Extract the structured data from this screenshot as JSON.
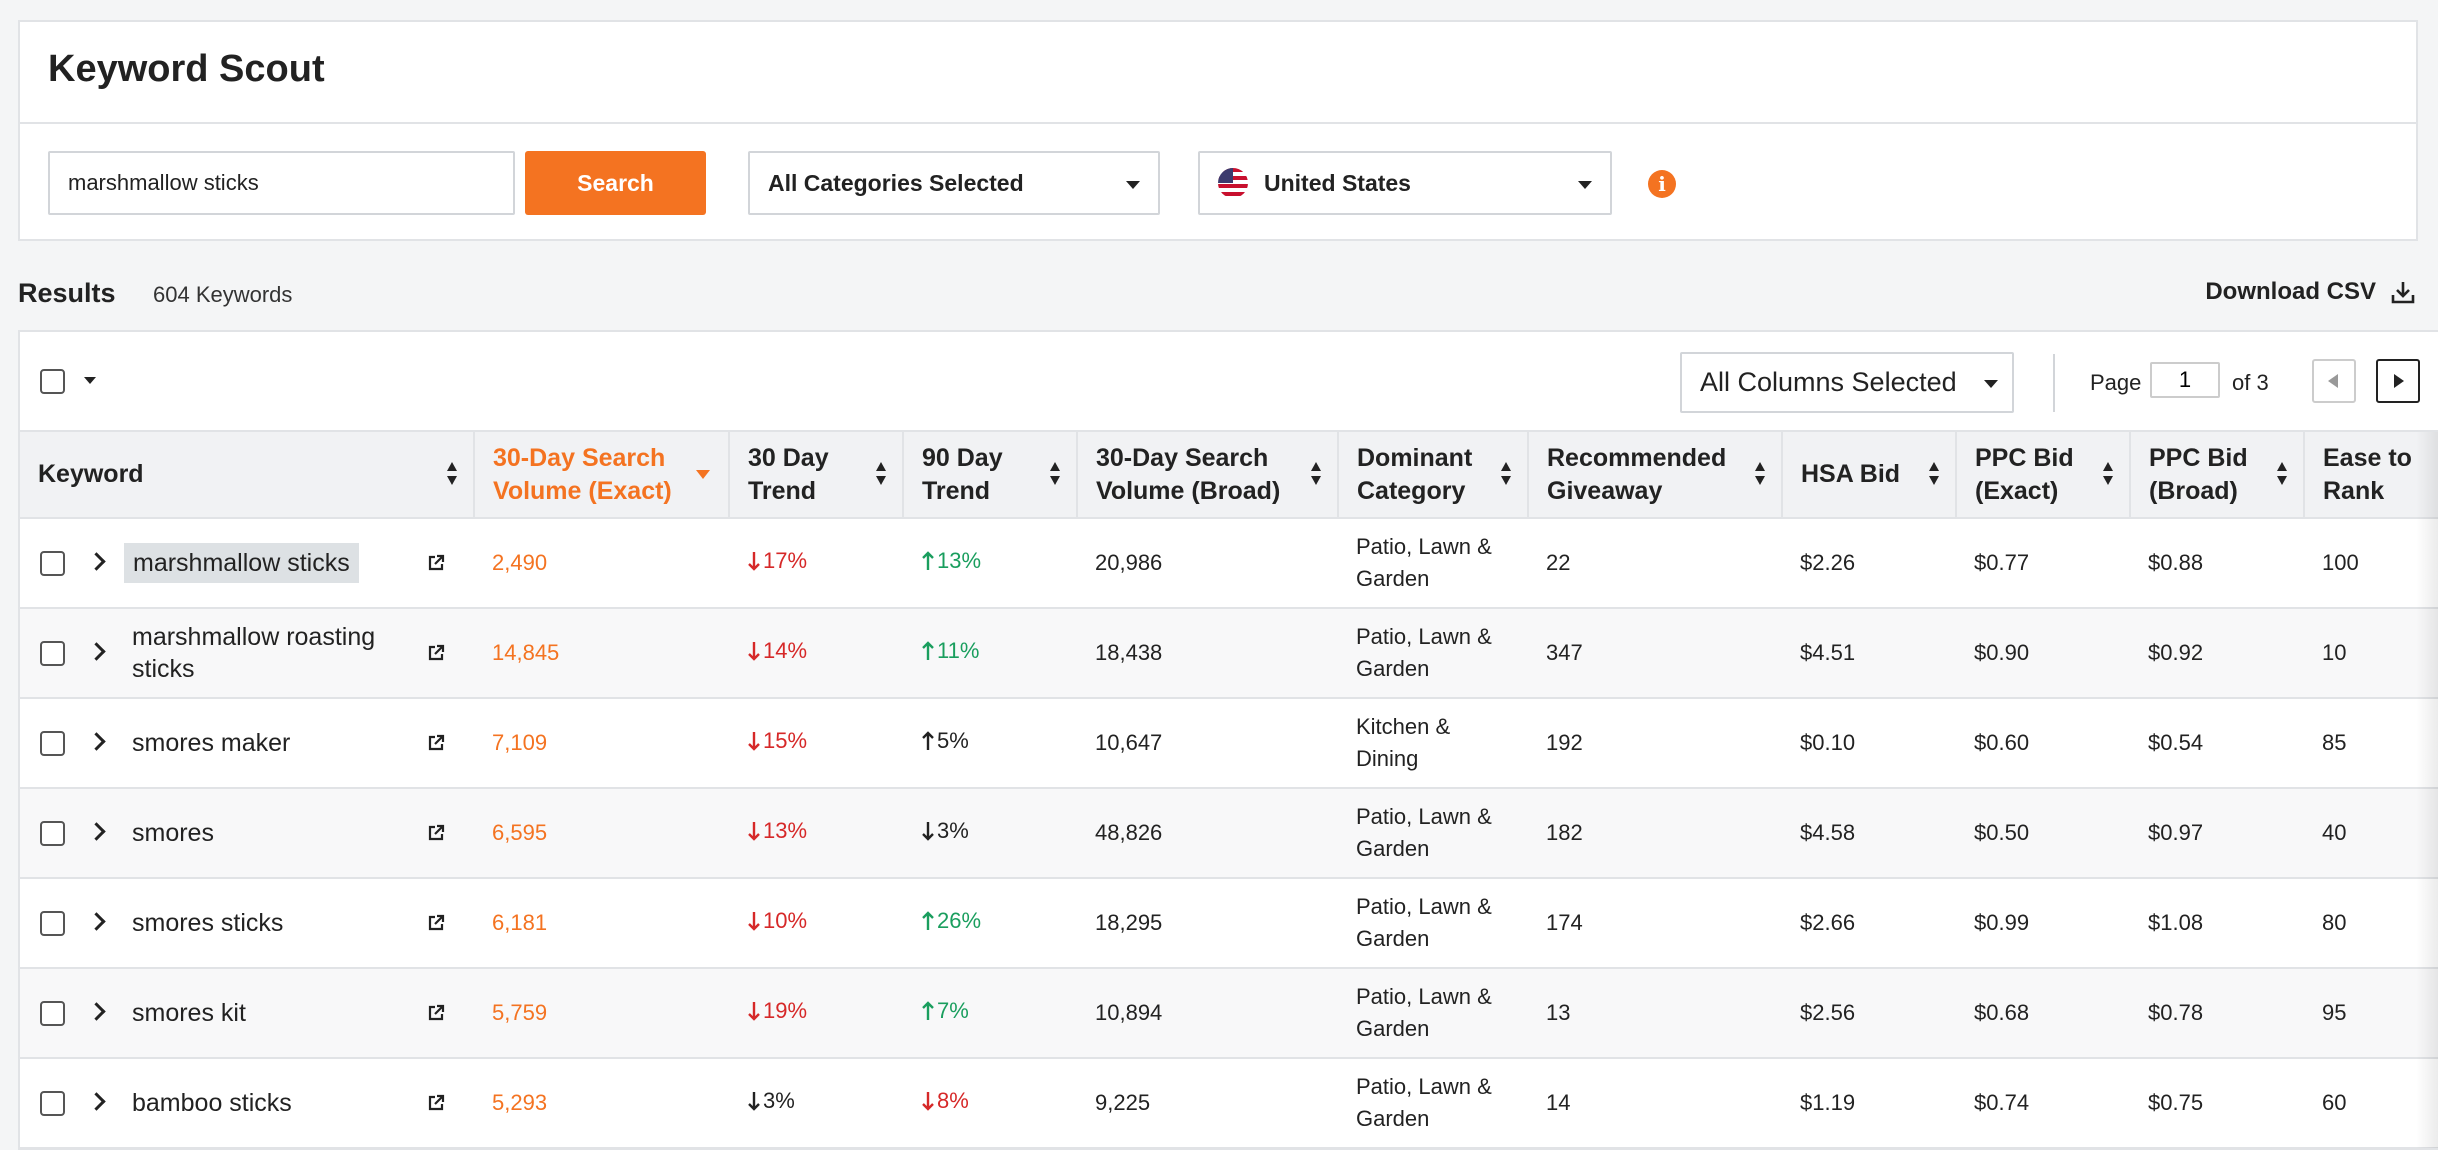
{
  "app": {
    "title": "Keyword Scout"
  },
  "search": {
    "value": "marshmallow sticks",
    "button_label": "Search"
  },
  "filters": {
    "category": "All Categories Selected",
    "country": "United States"
  },
  "results": {
    "label": "Results",
    "count": "604 Keywords",
    "download_label": "Download CSV"
  },
  "toolbar": {
    "columns_select": "All Columns Selected",
    "page_label": "Page",
    "page_value": "1",
    "page_of": "of 3"
  },
  "columns": [
    "Keyword",
    "30-Day Search Volume (Exact)",
    "30 Day Trend",
    "90 Day Trend",
    "30-Day Search Volume (Broad)",
    "Dominant Category",
    "Recommended Giveaway",
    "HSA Bid",
    "PPC Bid (Exact)",
    "PPC Bid (Broad)",
    "Ease to Rank"
  ],
  "rows": [
    {
      "keyword": "marshmallow sticks",
      "volume_exact": "2,490",
      "trend30": "17%",
      "trend30_dir": "down",
      "trend90": "13%",
      "trend90_dir": "up",
      "volume_broad": "20,986",
      "category": "Patio, Lawn & Garden",
      "giveaway": "22",
      "hsa": "$2.26",
      "ppc_exact": "$0.77",
      "ppc_broad": "$0.88",
      "ease": "100"
    },
    {
      "keyword": "marshmallow roasting sticks",
      "volume_exact": "14,845",
      "trend30": "14%",
      "trend30_dir": "down",
      "trend90": "11%",
      "trend90_dir": "up",
      "volume_broad": "18,438",
      "category": "Patio, Lawn & Garden",
      "giveaway": "347",
      "hsa": "$4.51",
      "ppc_exact": "$0.90",
      "ppc_broad": "$0.92",
      "ease": "10"
    },
    {
      "keyword": "smores maker",
      "volume_exact": "7,109",
      "trend30": "15%",
      "trend30_dir": "down",
      "trend90": "5%",
      "trend90_dir": "up-neutral",
      "volume_broad": "10,647",
      "category": "Kitchen & Dining",
      "giveaway": "192",
      "hsa": "$0.10",
      "ppc_exact": "$0.60",
      "ppc_broad": "$0.54",
      "ease": "85"
    },
    {
      "keyword": "smores",
      "volume_exact": "6,595",
      "trend30": "13%",
      "trend30_dir": "down",
      "trend90": "3%",
      "trend90_dir": "down-neutral",
      "volume_broad": "48,826",
      "category": "Patio, Lawn & Garden",
      "giveaway": "182",
      "hsa": "$4.58",
      "ppc_exact": "$0.50",
      "ppc_broad": "$0.97",
      "ease": "40"
    },
    {
      "keyword": "smores sticks",
      "volume_exact": "6,181",
      "trend30": "10%",
      "trend30_dir": "down",
      "trend90": "26%",
      "trend90_dir": "up",
      "volume_broad": "18,295",
      "category": "Patio, Lawn & Garden",
      "giveaway": "174",
      "hsa": "$2.66",
      "ppc_exact": "$0.99",
      "ppc_broad": "$1.08",
      "ease": "80"
    },
    {
      "keyword": "smores kit",
      "volume_exact": "5,759",
      "trend30": "19%",
      "trend30_dir": "down",
      "trend90": "7%",
      "trend90_dir": "up",
      "volume_broad": "10,894",
      "category": "Patio, Lawn & Garden",
      "giveaway": "13",
      "hsa": "$2.56",
      "ppc_exact": "$0.68",
      "ppc_broad": "$0.78",
      "ease": "95"
    },
    {
      "keyword": "bamboo sticks",
      "volume_exact": "5,293",
      "trend30": "3%",
      "trend30_dir": "down-neutral",
      "trend90": "8%",
      "trend90_dir": "down",
      "volume_broad": "9,225",
      "category": "Patio, Lawn & Garden",
      "giveaway": "14",
      "hsa": "$1.19",
      "ppc_exact": "$0.74",
      "ppc_broad": "$0.75",
      "ease": "60"
    }
  ],
  "colors": {
    "accent": "#f47321",
    "down": "#d62828",
    "up": "#1a9e5e"
  }
}
